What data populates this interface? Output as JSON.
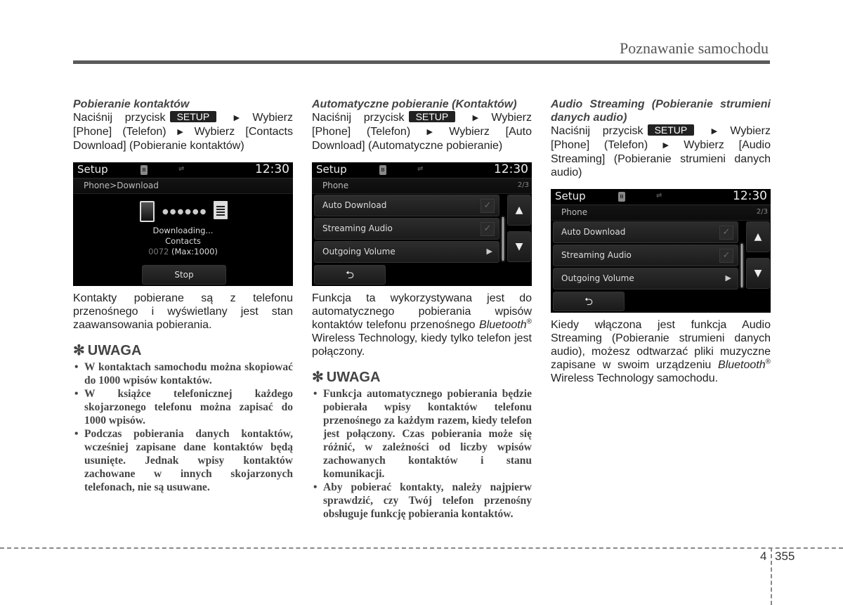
{
  "header": {
    "title": "Poznawanie samochodu"
  },
  "columns": [
    {
      "title": "Pobieranie kontaktów",
      "instruction": {
        "press": "Naciśnij przycisk",
        "button": "SETUP",
        "arrow": "▶",
        "step1": "Wybierz [Phone] (Telefon)",
        "step2": "Wybierz [Contacts Download] (Pobieranie kontaktów)"
      },
      "screen": {
        "title": "Setup",
        "time": "12:30",
        "bt_icon": "bluetooth-download-icon",
        "usb_icon": "usb-icon",
        "breadcrumb": "Phone>Download",
        "dots": "●●●●●●",
        "line1": "Downloading...",
        "line2": "Contacts",
        "count": "0072",
        "max": "(Max:1000)",
        "stop": "Stop"
      },
      "description": "Kontakty pobierane są z telefonu przenośnego i wyświetlany jest stan zaawansowania pobierania.",
      "note": {
        "star": "✻",
        "heading": "UWAGA",
        "items": [
          "W kontaktach samochodu można skopiować do 1000 wpisów kontaktów.",
          "W książce telefonicznej każdego skojarzonego telefonu można zapisać do 1000 wpisów.",
          "Podczas pobierania danych kontaktów, wcześniej zapisane dane kontaktów będą usunięte. Jednak wpisy kontaktów zachowane w innych skojarzonych telefonach, nie są usuwane."
        ]
      }
    },
    {
      "title": "Automatyczne pobieranie (Kontaktów)",
      "instruction": {
        "press": "Naciśnij przycisk",
        "button": "SETUP",
        "arrow": "▶",
        "step1": "Wybierz [Phone] (Telefon)",
        "step2": "Wybierz [Auto Download] (Automatyczne pobieranie)"
      },
      "screen": {
        "title": "Setup",
        "time": "12:30",
        "subtitle": "Phone",
        "page": "2/3",
        "items": [
          {
            "label": "Auto Download",
            "control": "✓"
          },
          {
            "label": "Streaming Audio",
            "control": "✓"
          },
          {
            "label": "Outgoing Volume",
            "control": "▶"
          }
        ],
        "up": "▲",
        "down": "▼",
        "back": "⮌"
      },
      "description": {
        "part1": "Funkcja ta wykorzystywana jest do automatycznego pobierania wpisów kontaktów telefonu przenośnego",
        "bt": "Bluetooth",
        "reg": "®",
        "part2": "Wireless Technology, kiedy tylko telefon jest połączony."
      },
      "note": {
        "star": "✻",
        "heading": "UWAGA",
        "items": [
          "Funkcja automatycznego pobierania będzie pobierała wpisy kontaktów telefonu przenośnego za każdym razem, kiedy telefon jest połączony. Czas pobierania może się różnić, w zależności od liczby wpisów zachowanych kontaktów i stanu komunikacji.",
          "Aby pobierać kontakty, należy najpierw sprawdzić, czy Twój telefon przenośny obsługuje funkcję pobierania kontaktów."
        ]
      }
    },
    {
      "title": "Audio Streaming (Pobieranie strumieni danych audio)",
      "instruction": {
        "press": "Naciśnij przycisk",
        "button": "SETUP",
        "arrow": "▶",
        "step1": "Wybierz [Phone] (Telefon)",
        "step2": "Wybierz [Audio Streaming] (Pobieranie strumieni danych audio)"
      },
      "screen": {
        "title": "Setup",
        "time": "12:30",
        "subtitle": "Phone",
        "page": "2/3",
        "items": [
          {
            "label": "Auto Download",
            "control": "✓"
          },
          {
            "label": "Streaming Audio",
            "control": "✓"
          },
          {
            "label": "Outgoing Volume",
            "control": "▶"
          }
        ],
        "up": "▲",
        "down": "▼",
        "back": "⮌"
      },
      "description": {
        "part1": "Kiedy włączona jest funkcja Audio Streaming (Pobieranie strumieni danych audio), możesz odtwarzać pliki muzyczne zapisane w swoim urządzeniu",
        "bt": "Bluetooth",
        "reg": "®",
        "part2": "Wireless Technology samochodu."
      }
    }
  ],
  "footer": {
    "chapter": "4",
    "page": "355"
  }
}
